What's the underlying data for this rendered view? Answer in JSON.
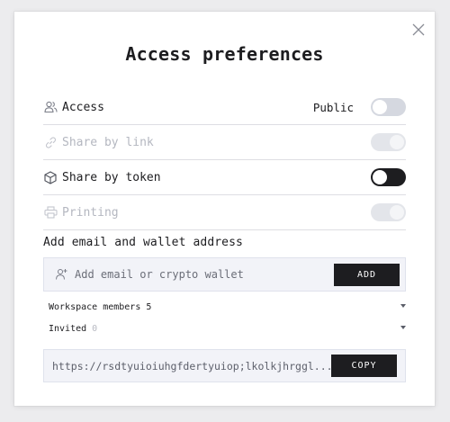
{
  "dialog": {
    "title": "Access preferences",
    "close_icon": "close-icon"
  },
  "settings": [
    {
      "id": "access",
      "icon": "users-icon",
      "label": "Access",
      "side_text": "Public",
      "toggle": "off",
      "disabled": false
    },
    {
      "id": "share-link",
      "icon": "link-icon",
      "label": "Share by link",
      "side_text": "",
      "toggle": "on",
      "disabled": true
    },
    {
      "id": "share-token",
      "icon": "cube-icon",
      "label": "Share by token",
      "side_text": "",
      "toggle": "on",
      "disabled": false
    },
    {
      "id": "printing",
      "icon": "printer-icon",
      "label": "Printing",
      "side_text": "",
      "toggle": "on",
      "disabled": true
    }
  ],
  "add_section": {
    "heading": "Add email and wallet address",
    "input_icon": "add-user-icon",
    "input_placeholder": "Add email or crypto wallet",
    "input_value": "",
    "add_button": "ADD"
  },
  "members": {
    "workspace_label": "Workspace members",
    "workspace_count": "5",
    "invited_label": "Invited",
    "invited_count": "0"
  },
  "link": {
    "url": "https://rsdtyuioiuhgfdertyuiop;lkolkjhrggl...",
    "copy_button": "COPY"
  },
  "colors": {
    "accent": "#1d1d20",
    "toggle_off": "#d5d8e0",
    "disabled_text": "#b4b7c0",
    "field_bg": "#f2f3f8"
  }
}
